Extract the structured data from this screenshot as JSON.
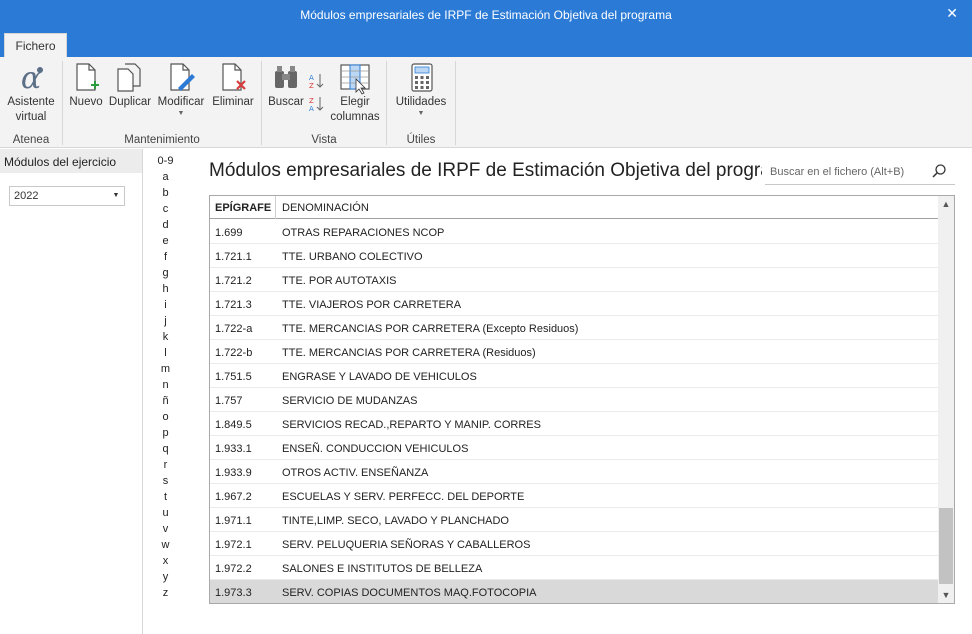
{
  "window": {
    "title": "Módulos empresariales de IRPF de Estimación Objetiva del programa",
    "close_glyph": "✕"
  },
  "tabs": {
    "fichero": "Fichero"
  },
  "ribbon": {
    "groups": {
      "atenea": "Atenea",
      "mantenimiento": "Mantenimiento",
      "vista": "Vista",
      "utiles": "Útiles"
    },
    "buttons": {
      "asistente_line1": "Asistente",
      "asistente_line2": "virtual",
      "nuevo": "Nuevo",
      "duplicar": "Duplicar",
      "modificar": "Modificar",
      "eliminar": "Eliminar",
      "buscar": "Buscar",
      "elegir_line1": "Elegir",
      "elegir_line2": "columnas",
      "utilidades": "Utilidades"
    },
    "accent_green": "#2e9b3e",
    "accent_red": "#d83b3b",
    "accent_blue": "#2b7bd6"
  },
  "left": {
    "header": "Módulos del ejercicio",
    "year": "2022"
  },
  "alphabet": [
    "0-9",
    "a",
    "b",
    "c",
    "d",
    "e",
    "f",
    "g",
    "h",
    "i",
    "j",
    "k",
    "l",
    "m",
    "n",
    "ñ",
    "o",
    "p",
    "q",
    "r",
    "s",
    "t",
    "u",
    "v",
    "w",
    "x",
    "y",
    "z"
  ],
  "main": {
    "title": "Módulos empresariales de IRPF de Estimación Objetiva del programa",
    "search_placeholder": "Buscar en el fichero (Alt+B)"
  },
  "table": {
    "columns": [
      "EPÍGRAFE",
      "DENOMINACIÓN"
    ],
    "rows": [
      [
        "1.699",
        "OTRAS REPARACIONES NCOP"
      ],
      [
        "1.721.1",
        "TTE. URBANO COLECTIVO"
      ],
      [
        "1.721.2",
        "TTE. POR AUTOTAXIS"
      ],
      [
        "1.721.3",
        "TTE. VIAJEROS POR CARRETERA"
      ],
      [
        "1.722-a",
        "TTE. MERCANCIAS POR CARRETERA (Excepto Residuos)"
      ],
      [
        "1.722-b",
        "TTE. MERCANCIAS POR CARRETERA (Residuos)"
      ],
      [
        "1.751.5",
        "ENGRASE Y LAVADO DE VEHICULOS"
      ],
      [
        "1.757",
        "SERVICIO DE MUDANZAS"
      ],
      [
        "1.849.5",
        "SERVICIOS RECAD.,REPARTO Y MANIP. CORRES"
      ],
      [
        "1.933.1",
        "ENSEÑ. CONDUCCION VEHICULOS"
      ],
      [
        "1.933.9",
        "OTROS ACTIV. ENSEÑANZA"
      ],
      [
        "1.967.2",
        "ESCUELAS Y SERV. PERFECC. DEL DEPORTE"
      ],
      [
        "1.971.1",
        "TINTE,LIMP. SECO, LAVADO Y PLANCHADO"
      ],
      [
        "1.972.1",
        "SERV. PELUQUERIA SEÑORAS Y CABALLEROS"
      ],
      [
        "1.972.2",
        "SALONES E INSTITUTOS DE BELLEZA"
      ],
      [
        "1.973.3",
        "SERV. COPIAS DOCUMENTOS MAQ.FOTOCOPIA"
      ]
    ],
    "selected_index": 15
  }
}
